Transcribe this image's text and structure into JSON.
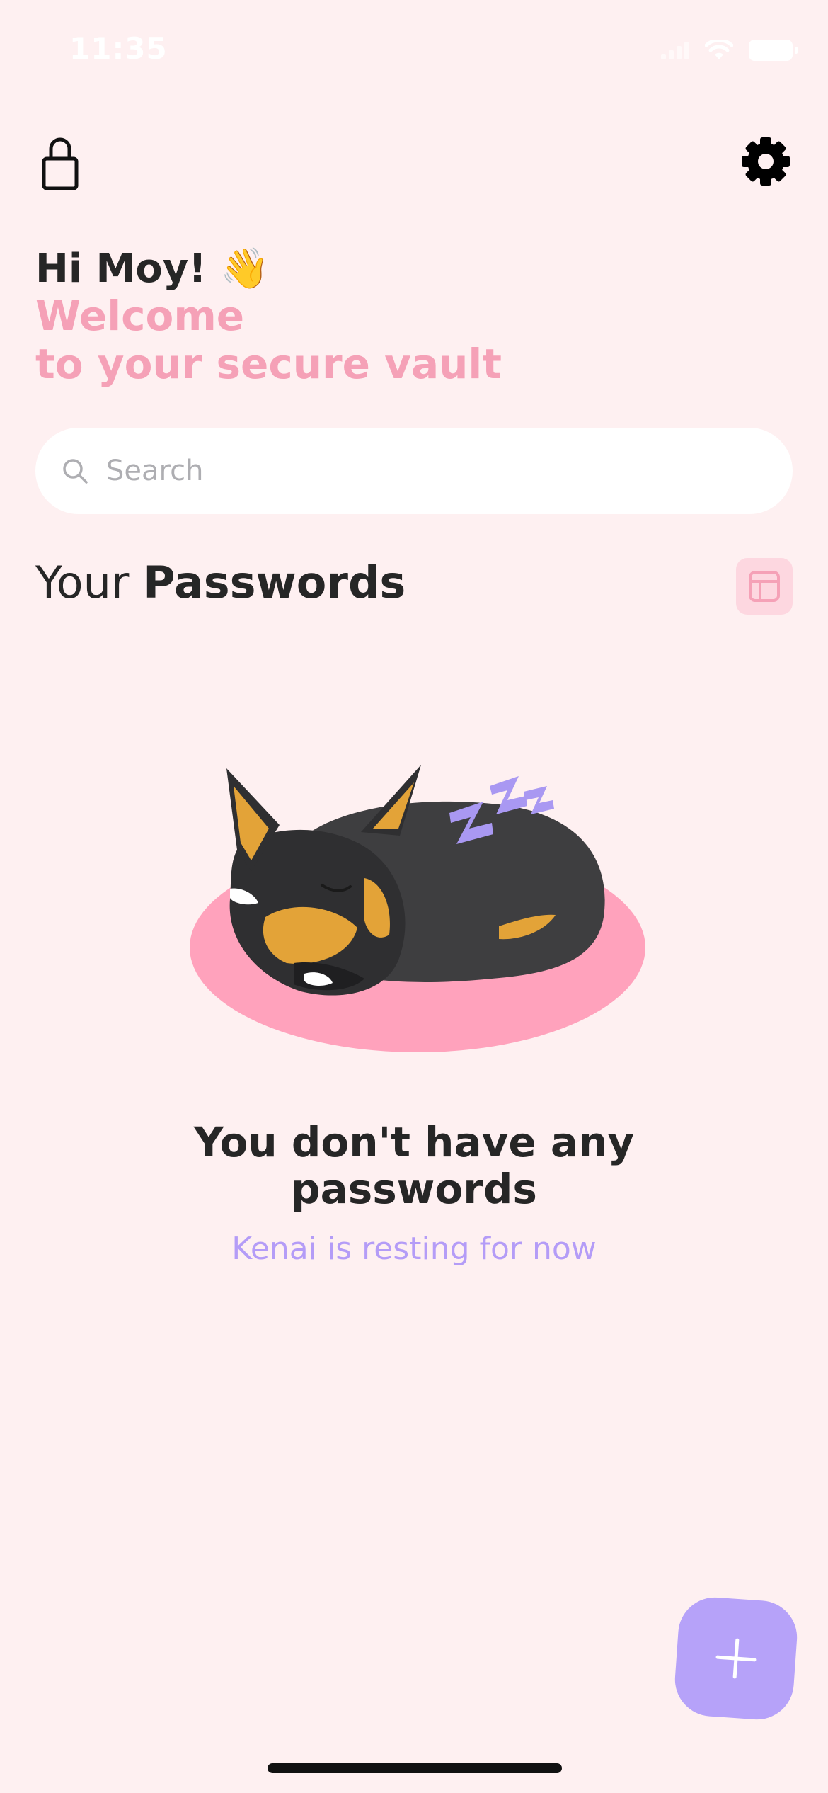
{
  "status_bar": {
    "time": "11:35"
  },
  "header": {
    "lock_icon": "lock-icon",
    "settings_icon": "gear-icon"
  },
  "greeting": {
    "hello": "Hi Moy! 👋",
    "welcome_line1": "Welcome",
    "welcome_line2": "to your secure vault"
  },
  "search": {
    "placeholder": "Search"
  },
  "section": {
    "title_light": "Your ",
    "title_bold": "Passwords",
    "layout_icon": "layout-icon"
  },
  "empty_state": {
    "title_line1": "You don't have any",
    "title_line2": "passwords",
    "subtitle": "Kenai is resting for now"
  },
  "fab": {
    "icon": "plus-icon"
  },
  "colors": {
    "background": "#FEF0F1",
    "pink_accent": "#F5A1B7",
    "purple_accent": "#B6A2F9",
    "subtitle_purple": "#B49CF7"
  }
}
